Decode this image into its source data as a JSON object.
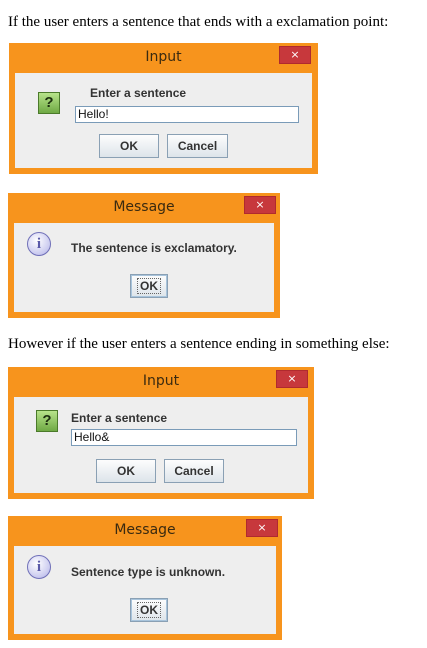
{
  "captions": {
    "first": "If the user enters a sentence that ends with a exclamation point:",
    "second": "However if the user enters a sentence ending in something else:"
  },
  "colors": {
    "frame": "#f7941d",
    "close": "#c7383c",
    "client": "#eeeeee"
  },
  "dialogs": [
    {
      "kind": "input",
      "title": "Input",
      "close": "×",
      "icon": "question-icon",
      "icon_glyph": "?",
      "prompt": "Enter a sentence",
      "value": "Hello!",
      "ok": "OK",
      "cancel": "Cancel"
    },
    {
      "kind": "message",
      "title": "Message",
      "close": "×",
      "icon": "info-icon",
      "icon_glyph": "i",
      "message": "The sentence is exclamatory.",
      "ok": "OK"
    },
    {
      "kind": "input",
      "title": "Input",
      "close": "×",
      "icon": "question-icon",
      "icon_glyph": "?",
      "prompt": "Enter a sentence",
      "value": "Hello&",
      "ok": "OK",
      "cancel": "Cancel"
    },
    {
      "kind": "message",
      "title": "Message",
      "close": "×",
      "icon": "info-icon",
      "icon_glyph": "i",
      "message": "Sentence type is unknown.",
      "ok": "OK"
    }
  ]
}
